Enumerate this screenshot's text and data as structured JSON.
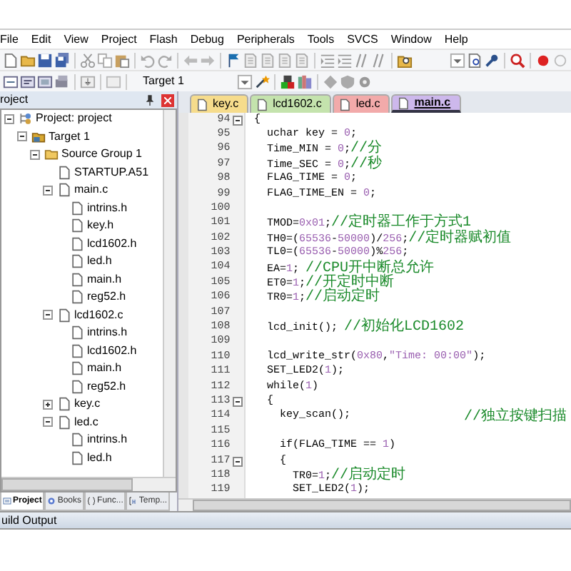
{
  "menu": [
    "File",
    "Edit",
    "View",
    "Project",
    "Flash",
    "Debug",
    "Peripherals",
    "Tools",
    "SVCS",
    "Window",
    "Help"
  ],
  "toolbar": {
    "target": "Target 1"
  },
  "project_panel": {
    "title": "roject",
    "tree": [
      {
        "label": "Project: project",
        "kind": "project",
        "expanded": true,
        "children": [
          {
            "label": "Target 1",
            "kind": "target",
            "expanded": true,
            "children": [
              {
                "label": "Source Group 1",
                "kind": "group",
                "expanded": true,
                "children": [
                  {
                    "label": "STARTUP.A51",
                    "kind": "file"
                  },
                  {
                    "label": "main.c",
                    "kind": "file",
                    "expanded": true,
                    "children": [
                      {
                        "label": "intrins.h",
                        "kind": "file"
                      },
                      {
                        "label": "key.h",
                        "kind": "file"
                      },
                      {
                        "label": "lcd1602.h",
                        "kind": "file"
                      },
                      {
                        "label": "led.h",
                        "kind": "file"
                      },
                      {
                        "label": "main.h",
                        "kind": "file"
                      },
                      {
                        "label": "reg52.h",
                        "kind": "file"
                      }
                    ]
                  },
                  {
                    "label": "lcd1602.c",
                    "kind": "file",
                    "expanded": true,
                    "children": [
                      {
                        "label": "intrins.h",
                        "kind": "file"
                      },
                      {
                        "label": "lcd1602.h",
                        "kind": "file"
                      },
                      {
                        "label": "main.h",
                        "kind": "file"
                      },
                      {
                        "label": "reg52.h",
                        "kind": "file"
                      }
                    ]
                  },
                  {
                    "label": "key.c",
                    "kind": "file",
                    "expanded": false
                  },
                  {
                    "label": "led.c",
                    "kind": "file",
                    "expanded": true,
                    "children": [
                      {
                        "label": "intrins.h",
                        "kind": "file"
                      },
                      {
                        "label": "led.h",
                        "kind": "file"
                      }
                    ]
                  }
                ]
              }
            ]
          }
        ]
      }
    ],
    "tabs": [
      {
        "label": "Project",
        "selected": true
      },
      {
        "label": "Books",
        "selected": false
      },
      {
        "label": "Func...",
        "selected": false
      },
      {
        "label": "Temp...",
        "selected": false
      }
    ]
  },
  "editor": {
    "tabs": [
      {
        "label": "key.c",
        "color": "#f6dc8c",
        "selected": false
      },
      {
        "label": "lcd1602.c",
        "color": "#c4e3ad",
        "selected": false
      },
      {
        "label": "led.c",
        "color": "#f2aaaa",
        "selected": false
      },
      {
        "label": "main.c",
        "color": "#cdb8ec",
        "selected": true
      }
    ],
    "lines": [
      {
        "number": "94",
        "code": "{",
        "fold": true
      },
      {
        "number": "95",
        "code": "  uchar key = 0;"
      },
      {
        "number": "96",
        "code": "  Time_MIN = 0;",
        "comment": "//分"
      },
      {
        "number": "97",
        "code": "  Time_SEC = 0;",
        "comment": "//秒"
      },
      {
        "number": "98",
        "code": "  FLAG_TIME = 0;"
      },
      {
        "number": "99",
        "code": "  FLAG_TIME_EN = 0;"
      },
      {
        "number": "100"
      },
      {
        "number": "101",
        "code": "  TMOD=0x01;",
        "comment": "//定时器工作于方式1"
      },
      {
        "number": "102",
        "code": "  TH0=(65536-50000)/256;",
        "comment": "//定时器赋初值"
      },
      {
        "number": "103",
        "code": "  TL0=(65536-50000)%256;"
      },
      {
        "number": "104",
        "code": "  EA=1; ",
        "comment": "//CPU开中断总允许"
      },
      {
        "number": "105",
        "code": "  ET0=1;",
        "comment": "//开定时中断"
      },
      {
        "number": "106",
        "code": "  TR0=1;",
        "comment": "//启动定时"
      },
      {
        "number": "107"
      },
      {
        "number": "108",
        "code": "  lcd_init(); ",
        "comment": "//初始化LCD1602"
      },
      {
        "number": "109"
      },
      {
        "number": "110",
        "code": "  lcd_write_str(0x80,\"Time: 00:00\");"
      },
      {
        "number": "111",
        "code": "  SET_LED2(1);"
      },
      {
        "number": "112",
        "code": "  while(1)"
      },
      {
        "number": "113",
        "code": "  {",
        "fold": true
      },
      {
        "number": "114",
        "code": "    key_scan();",
        "comment": "//独立按键扫描",
        "comment_far": true
      },
      {
        "number": "115"
      },
      {
        "number": "116",
        "code": "    if(FLAG_TIME == 1)"
      },
      {
        "number": "117",
        "code": "    {",
        "fold": true
      },
      {
        "number": "118",
        "code": "      TR0=1;",
        "comment": "//启动定时"
      },
      {
        "number": "119",
        "code": "      SET_LED2(1);"
      }
    ]
  },
  "build_output": {
    "title": "uild Output"
  }
}
